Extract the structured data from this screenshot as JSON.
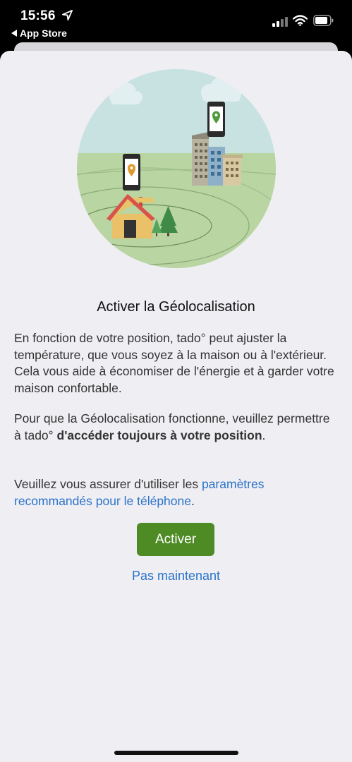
{
  "status_bar": {
    "time": "15:56",
    "back_label": "App Store"
  },
  "content": {
    "title": "Activer la Géolocalisation",
    "paragraph1": "En fonction de votre position, tado° peut ajuster la température, que vous soyez à la maison ou à l'extérieur. Cela vous aide à économiser de l'énergie et à garder votre maison confortable.",
    "paragraph2_prefix": "Pour que la Géolocalisation fonctionne, veuillez permettre à tado° ",
    "paragraph2_bold": "d'accéder toujours à votre position",
    "paragraph2_suffix": ".",
    "paragraph3_prefix": "Veuillez vous assurer d'utiliser les ",
    "paragraph3_link": "paramètres recommandés pour le téléphone",
    "paragraph3_suffix": "."
  },
  "actions": {
    "activate_label": "Activer",
    "not_now_label": "Pas maintenant"
  },
  "colors": {
    "accent_green": "#4f8b25",
    "link_blue": "#2a73c9",
    "sheet_background": "#efeef3"
  },
  "icons": {
    "location_arrow": "location-arrow-icon",
    "signal": "cellular-signal-icon",
    "wifi": "wifi-icon",
    "battery": "battery-icon"
  }
}
